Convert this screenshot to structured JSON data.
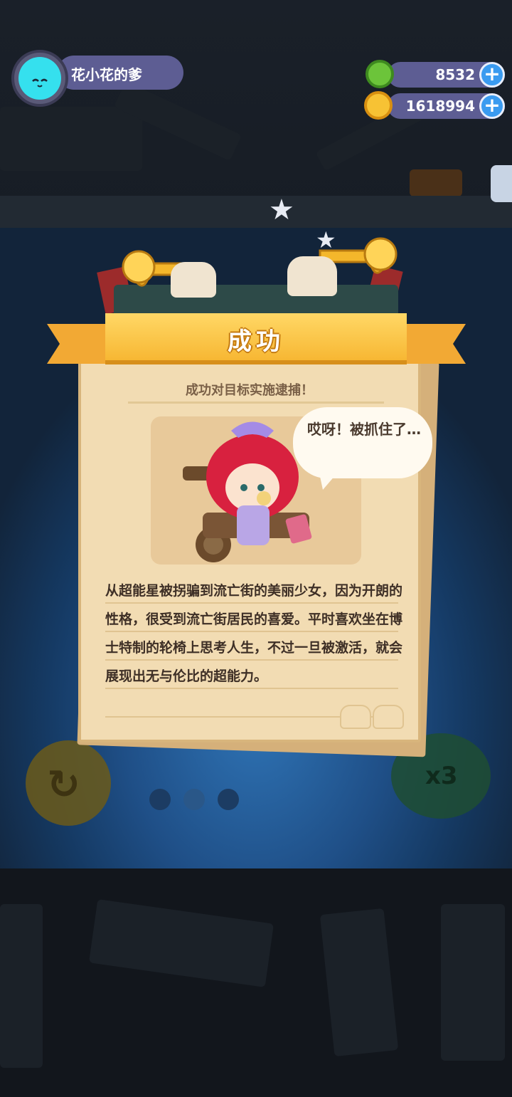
{
  "player": {
    "name": "花小花的爹",
    "avatar_color": "#35e0ee"
  },
  "resources": [
    {
      "value": "8532",
      "icon": "green-gem-icon"
    },
    {
      "value": "1618994",
      "icon": "gold-coin-icon"
    }
  ],
  "result": {
    "title": "成功",
    "subtitle": "成功对目标实施逮捕！",
    "speech": "哎呀！被抓住了…",
    "description": "从超能星被拐骗到流亡街的美丽少女，因为开朗的性格，很受到流亡街居民的喜爱。平时喜欢坐在博士特制的轮椅上思考人生，不过一旦被激活，就会展现出无与伦比的超能力。"
  },
  "controls": {
    "speed_label": "x3"
  },
  "colors": {
    "ribbon": "#f7b733",
    "paper": "#f2dcb3",
    "stage_blue": "#2f74b6"
  }
}
